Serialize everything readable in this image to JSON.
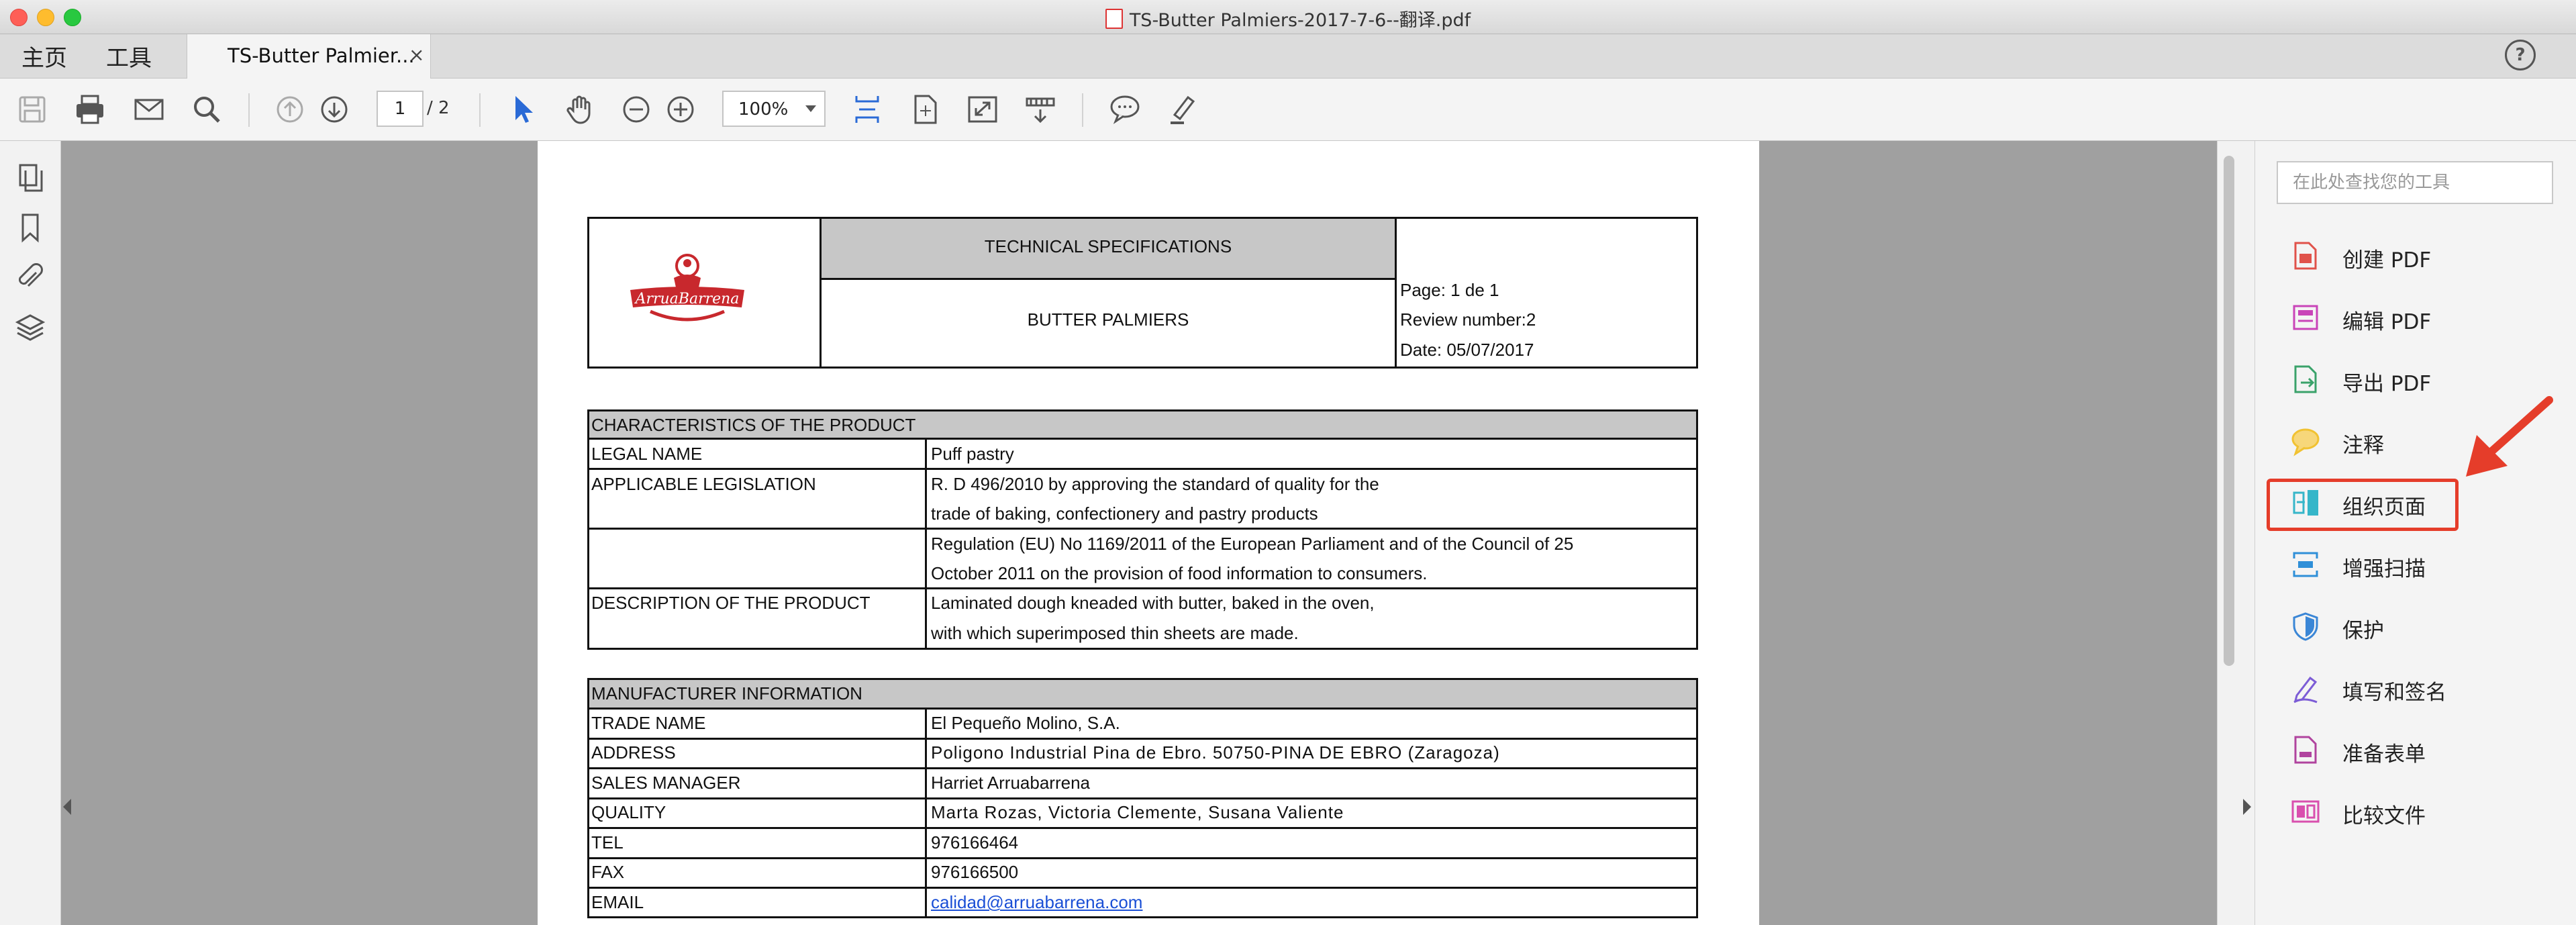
{
  "window": {
    "title": "TS-Butter Palmiers-2017-7-6--翻译.pdf"
  },
  "nav": {
    "home": "主页",
    "tools": "工具"
  },
  "tab": {
    "label": "TS-Butter Palmier...",
    "close": "×"
  },
  "help": "?",
  "toolbar": {
    "page_current": "1",
    "page_total": "/ 2",
    "zoom": "100%"
  },
  "right_panel": {
    "search_placeholder": "在此处查找您的工具",
    "tools": [
      {
        "label": "创建 PDF",
        "icon": "create-pdf-icon",
        "color": "#e0524a"
      },
      {
        "label": "编辑 PDF",
        "icon": "edit-pdf-icon",
        "color": "#c944b8"
      },
      {
        "label": "导出 PDF",
        "icon": "export-pdf-icon",
        "color": "#3aa26a"
      },
      {
        "label": "注释",
        "icon": "comment-icon",
        "color": "#f1c232"
      },
      {
        "label": "组织页面",
        "icon": "organize-pages-icon",
        "color": "#36b6c9"
      },
      {
        "label": "增强扫描",
        "icon": "enhance-scan-icon",
        "color": "#2f8fd8"
      },
      {
        "label": "保护",
        "icon": "protect-icon",
        "color": "#3a86d6"
      },
      {
        "label": "填写和签名",
        "icon": "fill-sign-icon",
        "color": "#7c5cd6"
      },
      {
        "label": "准备表单",
        "icon": "prepare-form-icon",
        "color": "#b0439e"
      },
      {
        "label": "比较文件",
        "icon": "compare-files-icon",
        "color": "#d94fae"
      }
    ]
  },
  "doc": {
    "logo_text": "ArruaBarrena",
    "header_title": "TECHNICAL SPECIFICATIONS",
    "product": "BUTTER PALMIERS",
    "page": "Page: 1 de 1",
    "review": "Review number:2",
    "date": "Date: 05/07/2017",
    "char_header": "CHARACTERISTICS OF THE PRODUCT",
    "legal_name_label": "LEGAL NAME",
    "legal_name_value": "Puff pastry",
    "legislation_label": "APPLICABLE LEGISLATION",
    "legislation_lines": [
      "R. D 496/2010 by approving the standard of quality for the",
      "trade of baking, confectionery and pastry products",
      "Regulation (EU) No 1169/2011 of the European Parliament and of the Council of 25",
      "October 2011 on the provision of food information to consumers."
    ],
    "description_label": "DESCRIPTION OF THE PRODUCT",
    "description_lines": [
      "Laminated dough kneaded with butter, baked in the oven,",
      "with which superimposed thin sheets are made."
    ],
    "manu_header": "MANUFACTURER INFORMATION",
    "manufacturer_rows": [
      {
        "label": "TRADE NAME",
        "value": "El Pequeño Molino, S.A."
      },
      {
        "label": "ADDRESS",
        "value": "Poligono Industrial Pina de Ebro. 50750-PINA DE EBRO (Zaragoza)"
      },
      {
        "label": "SALES MANAGER",
        "value": "Harriet Arruabarrena"
      },
      {
        "label": "QUALITY",
        "value": "Marta Rozas, Victoria Clemente, Susana Valiente"
      },
      {
        "label": "TEL",
        "value": "976166464"
      },
      {
        "label": "FAX",
        "value": "976166500"
      },
      {
        "label": "EMAIL",
        "value": "calidad@arruabarrena.com"
      }
    ]
  }
}
